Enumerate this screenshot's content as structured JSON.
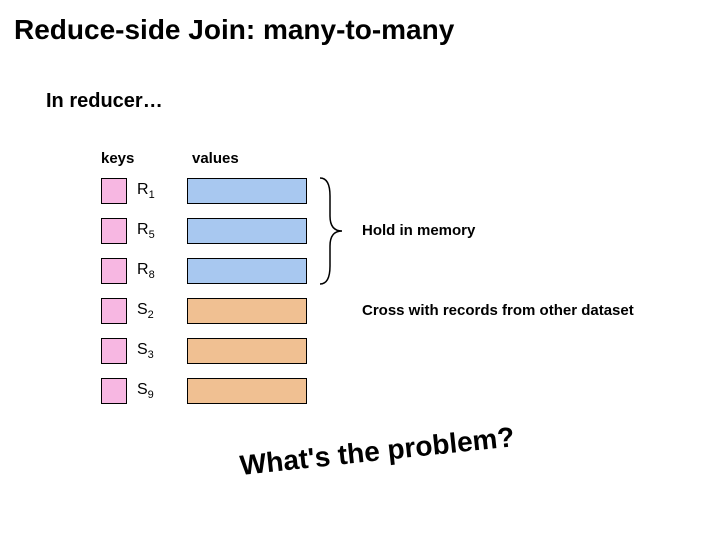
{
  "title": "Reduce-side Join: many-to-many",
  "subtitle": "In reducer…",
  "headers": {
    "keys": "keys",
    "values": "values"
  },
  "colors": {
    "keyR": "#f7b7e2",
    "keyS": "#f7b7e2",
    "valR": "#a8c8f0",
    "valS": "#f0c092"
  },
  "rows": [
    {
      "label_main": "R",
      "label_sub": "1",
      "group": "R"
    },
    {
      "label_main": "R",
      "label_sub": "5",
      "group": "R"
    },
    {
      "label_main": "R",
      "label_sub": "8",
      "group": "R"
    },
    {
      "label_main": "S",
      "label_sub": "2",
      "group": "S"
    },
    {
      "label_main": "S",
      "label_sub": "3",
      "group": "S"
    },
    {
      "label_main": "S",
      "label_sub": "9",
      "group": "S"
    }
  ],
  "annotations": {
    "hold": "Hold in memory",
    "cross": "Cross with records from other dataset"
  },
  "question": "What's the problem?"
}
